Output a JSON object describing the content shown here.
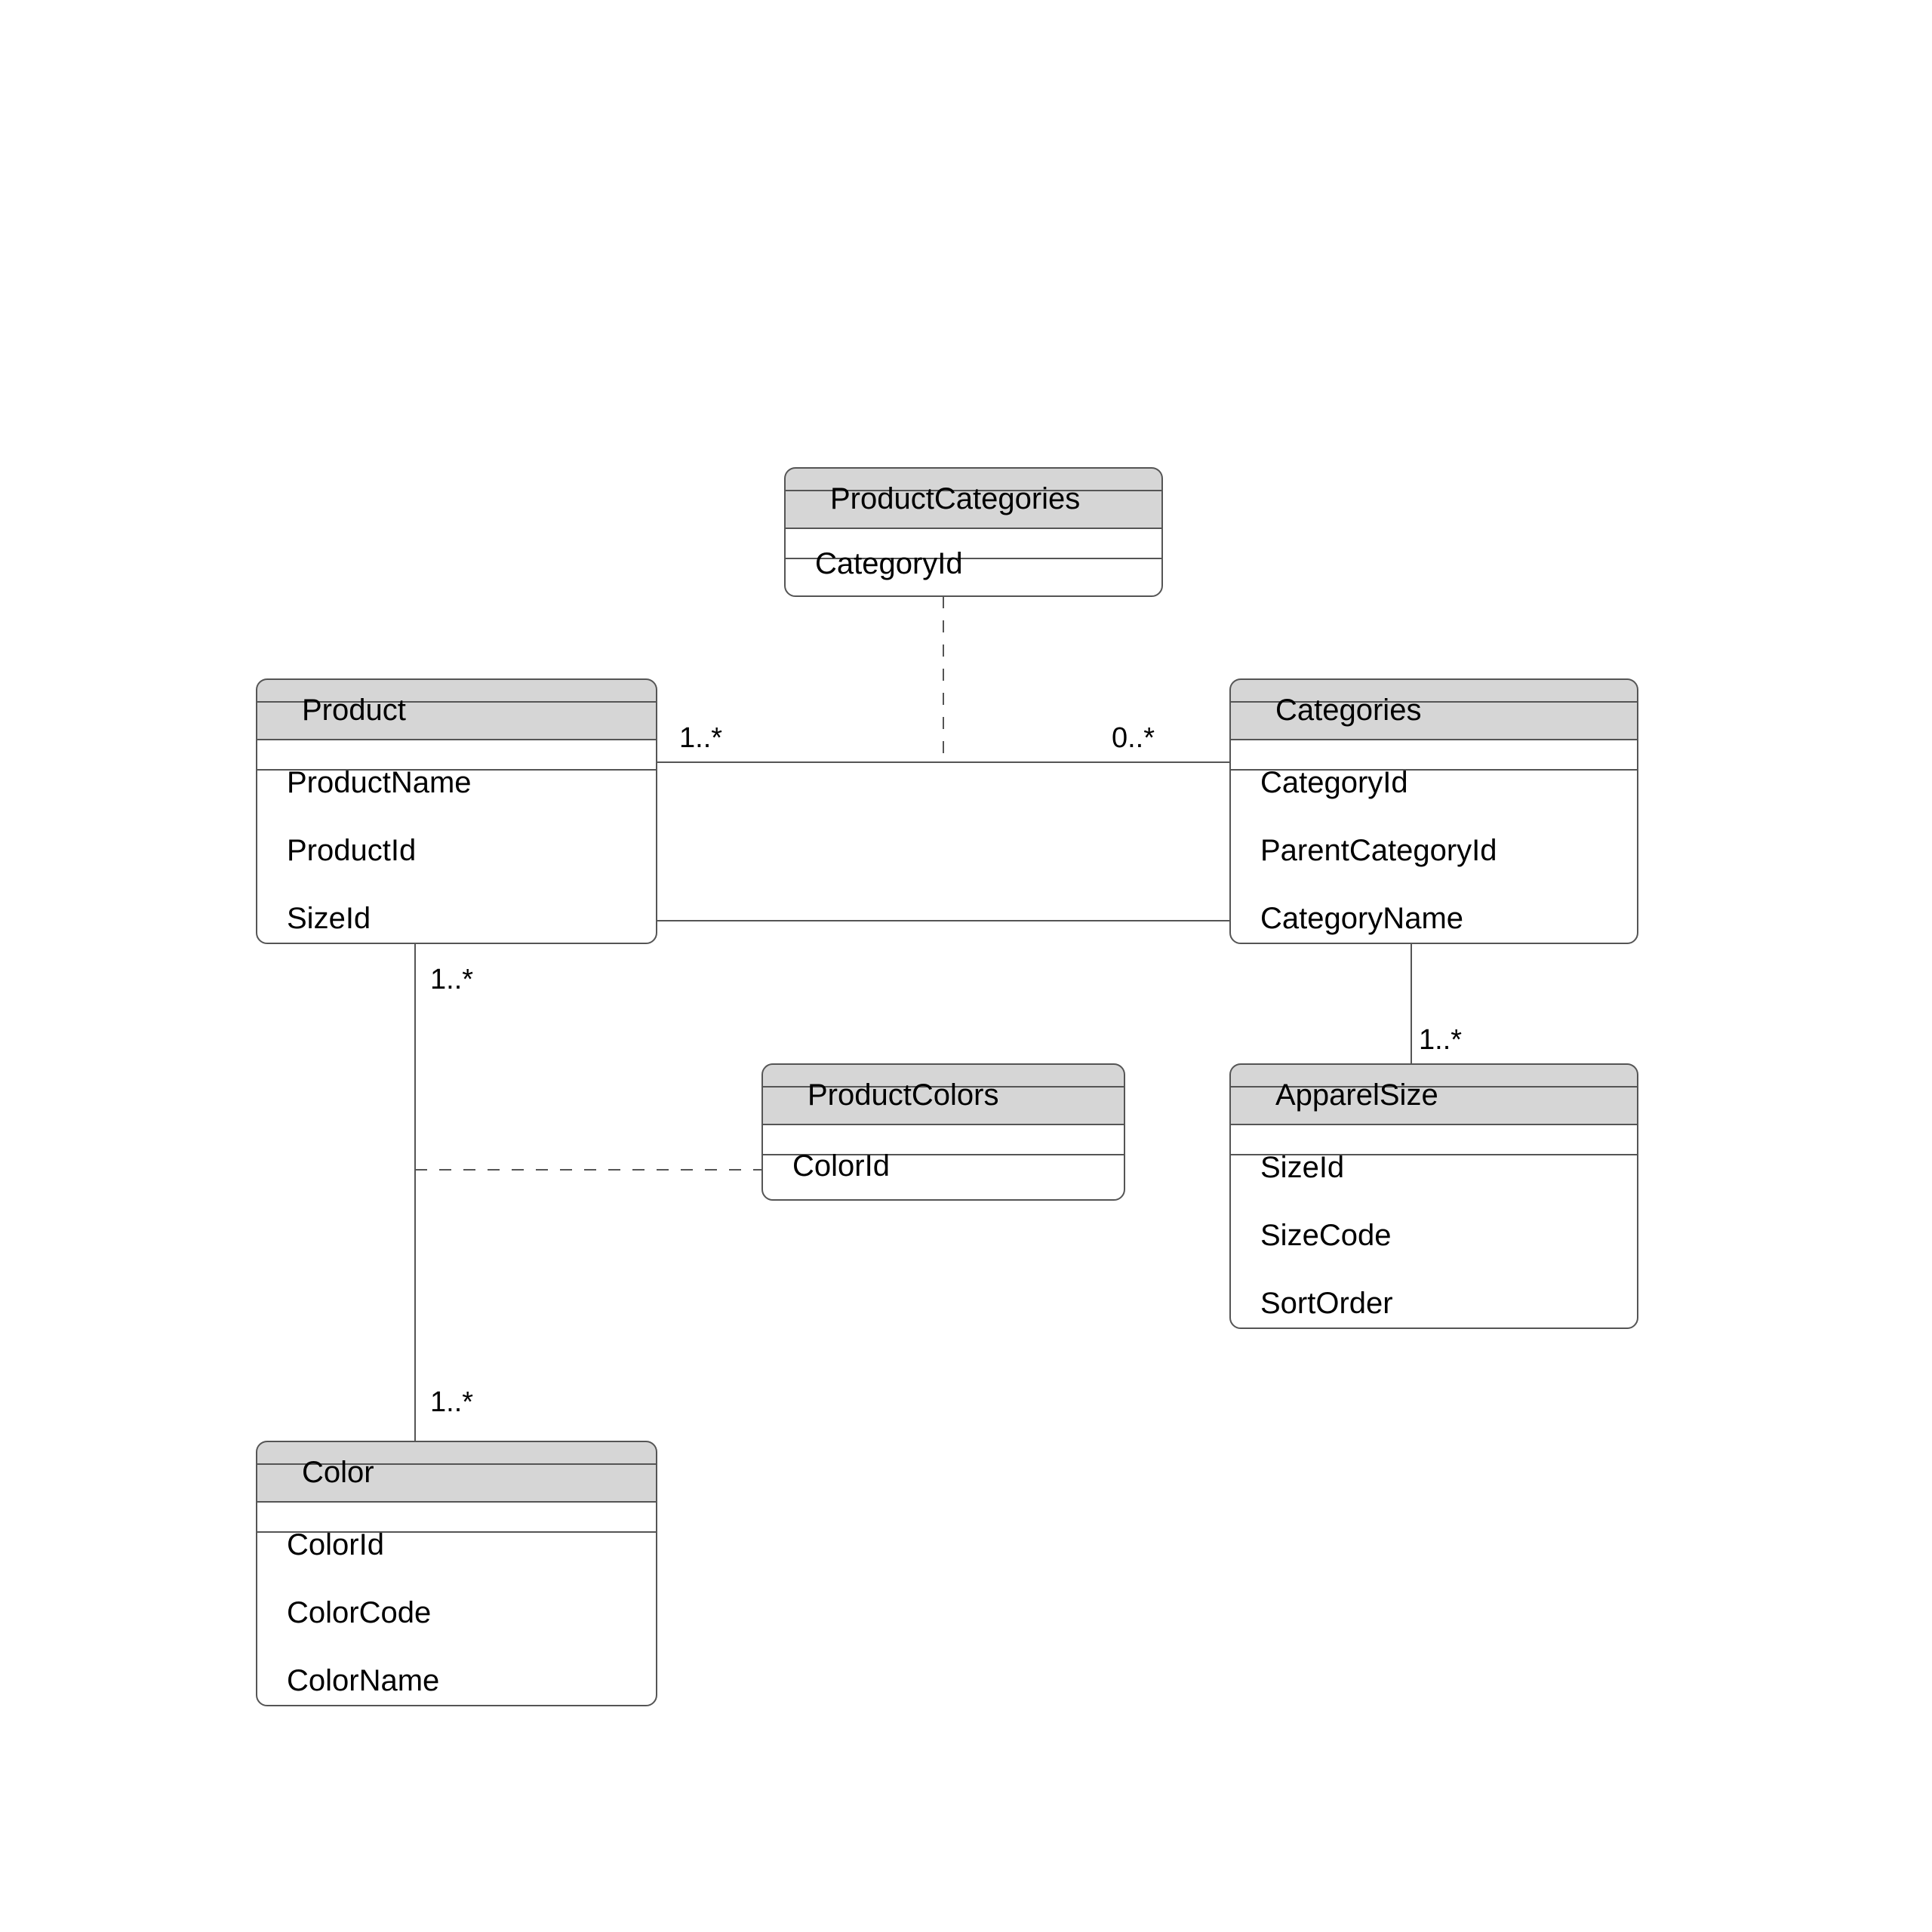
{
  "diagram": {
    "entities": {
      "productCategories": {
        "title": "ProductCategories",
        "attrs": [
          "CategoryId"
        ]
      },
      "product": {
        "title": "Product",
        "attrs": [
          "ProductName",
          "ProductId",
          "SizeId"
        ]
      },
      "categories": {
        "title": "Categories",
        "attrs": [
          "CategoryId",
          "ParentCategoryId",
          "CategoryName"
        ]
      },
      "productColors": {
        "title": "ProductColors",
        "attrs": [
          "ColorId"
        ]
      },
      "apparelSize": {
        "title": "ApparelSize",
        "attrs": [
          "SizeId",
          "SizeCode",
          "SortOrder"
        ]
      },
      "color": {
        "title": "Color",
        "attrs": [
          "ColorId",
          "ColorCode",
          "ColorName"
        ]
      }
    },
    "multiplicities": {
      "prodCat_left": "1..*",
      "prodCat_right": "0..*",
      "prodSize_left": "1..*",
      "prodSize_right": "1..*",
      "prodColor_top": "1..*",
      "prodColor_bot": "1..*"
    }
  }
}
